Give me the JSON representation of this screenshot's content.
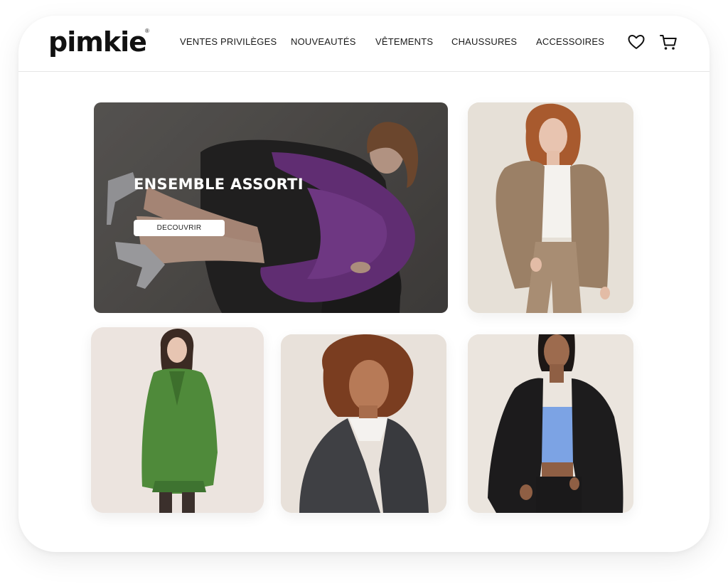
{
  "brand": {
    "logo_text": "pimkie",
    "registered_mark": "®"
  },
  "nav": {
    "items": [
      {
        "label": "VENTES PRIVILÈGES"
      },
      {
        "label": "NOUVEAUTÉS"
      },
      {
        "label": "VÊTEMENTS"
      },
      {
        "label": "CHAUSSURES"
      },
      {
        "label": "ACCESSOIRES"
      }
    ]
  },
  "header_icons": {
    "wishlist_icon": "heart-icon",
    "cart_icon": "cart-icon"
  },
  "hero": {
    "title": "ENSEMBLE ASSORTI",
    "cta_label": "DECOUVRIR"
  },
  "products": [
    {
      "photo": "woman in beige blazer suit"
    },
    {
      "photo": "woman in green houndstooth blazer and skirt"
    },
    {
      "photo": "woman in grey wool coat"
    },
    {
      "photo": "woman in black blazer with blue top"
    }
  ],
  "colors": {
    "text": "#1a1a1a",
    "hero_overlay": "#5b5855",
    "hero_text": "#ffffff",
    "tile_background": "#e6dfd8"
  }
}
